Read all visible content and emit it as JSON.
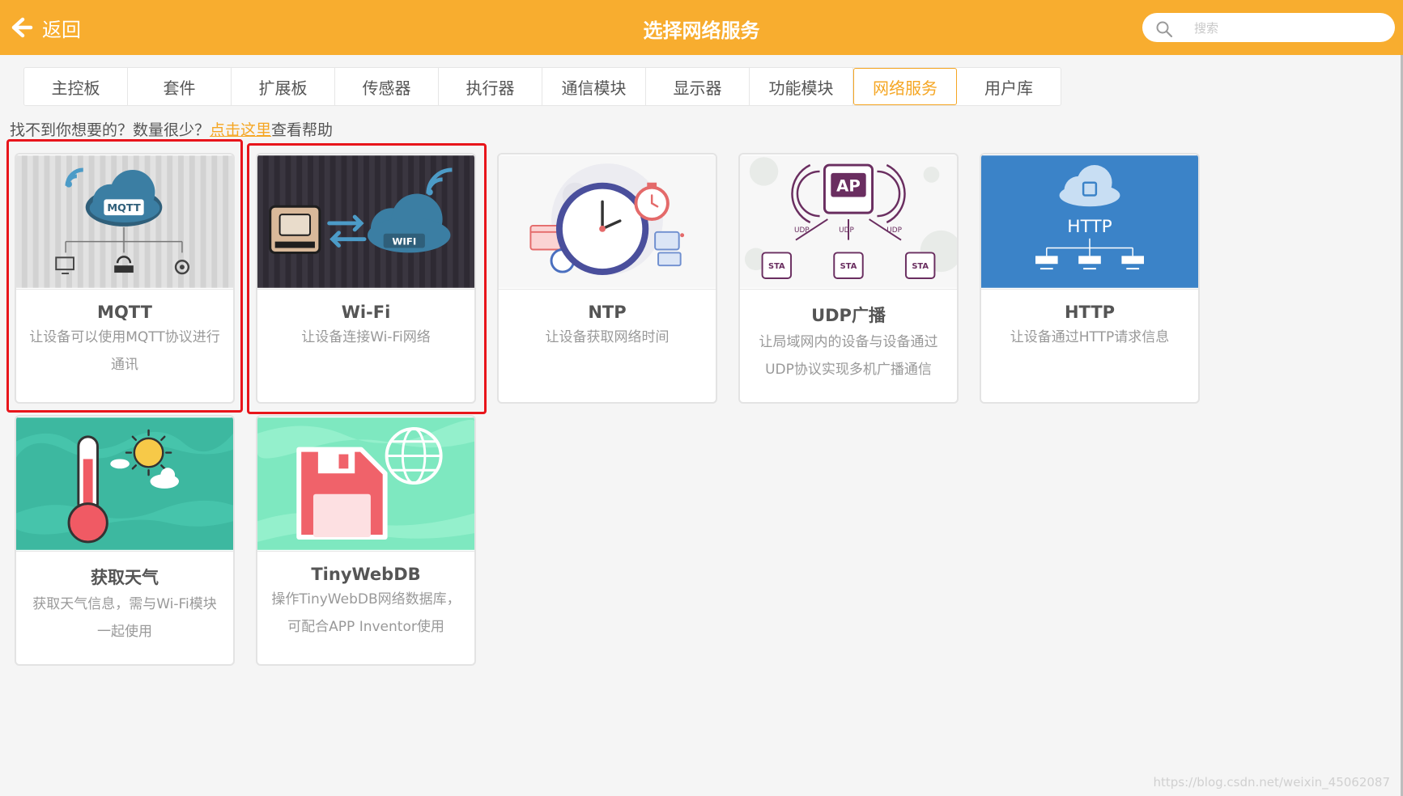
{
  "header": {
    "back_label": "返回",
    "title": "选择网络服务",
    "search_placeholder": "搜索"
  },
  "tabs": [
    {
      "label": "主控板"
    },
    {
      "label": "套件"
    },
    {
      "label": "扩展板"
    },
    {
      "label": "传感器"
    },
    {
      "label": "执行器"
    },
    {
      "label": "通信模块"
    },
    {
      "label": "显示器"
    },
    {
      "label": "功能模块"
    },
    {
      "label": "网络服务",
      "active": true
    },
    {
      "label": "用户库"
    }
  ],
  "help": {
    "prefix": "找不到你想要的？数量很少？",
    "link": "点击这里",
    "suffix": "查看帮助"
  },
  "cards": [
    {
      "title": "MQTT",
      "desc": "让设备可以使用MQTT协议进行通讯",
      "icon": "mqtt-cloud-icon",
      "highlighted": true
    },
    {
      "title": "Wi-Fi",
      "desc": "让设备连接Wi-Fi网络",
      "icon": "wifi-cloud-icon",
      "highlighted": true
    },
    {
      "title": "NTP",
      "desc": "让设备获取网络时间",
      "icon": "clock-icon"
    },
    {
      "title": "UDP广播",
      "desc": "让局域网内的设备与设备通过UDP协议实现多机广播通信",
      "icon": "udp-broadcast-icon"
    },
    {
      "title": "HTTP",
      "desc": "让设备通过HTTP请求信息",
      "icon": "http-cloud-icon"
    },
    {
      "title": "获取天气",
      "desc": "获取天气信息，需与Wi-Fi模块一起使用",
      "icon": "weather-icon"
    },
    {
      "title": "TinyWebDB",
      "desc": "操作TinyWebDB网络数据库，可配合APP Inventor使用",
      "icon": "database-globe-icon"
    }
  ],
  "image_text": {
    "mqtt": "MQTT",
    "wifi": "WIFI",
    "ap": "AP",
    "udp": "UDP",
    "sta": "STA",
    "http": "HTTP"
  },
  "colors": {
    "header": "#f8ad2f",
    "accent": "#f5a623",
    "highlight": "#e8151b"
  },
  "watermark": "https://blog.csdn.net/weixin_45062087"
}
